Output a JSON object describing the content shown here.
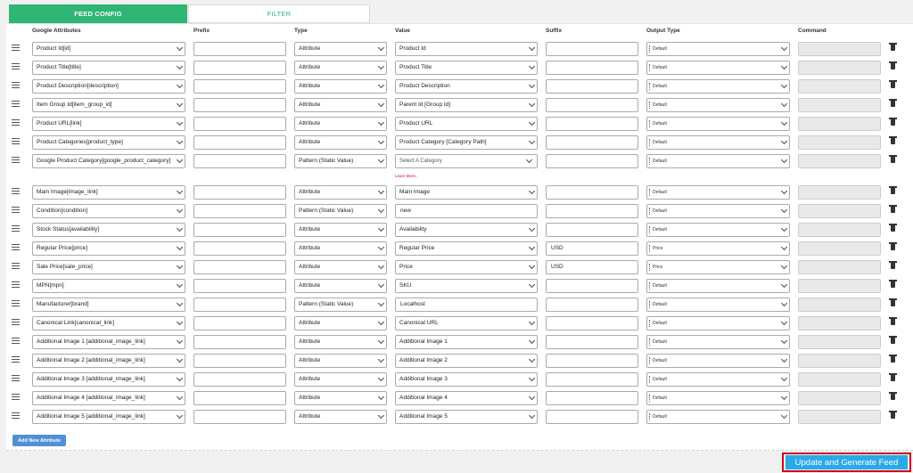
{
  "tabs": [
    {
      "label": "FEED CONFIG"
    },
    {
      "label": "FILTER"
    }
  ],
  "headers": {
    "google": "Google Attributes",
    "prefix": "Prefix",
    "type": "Type",
    "value": "Value",
    "suffix": "Suffix",
    "output": "Output Type",
    "command": "Command"
  },
  "rows": [
    {
      "google": "Product Id[id]",
      "prefix": "",
      "type": "Attribute",
      "value": "Product Id",
      "value_kind": "select",
      "suffix": "",
      "output": "Default"
    },
    {
      "google": "Product Title[title]",
      "prefix": "",
      "type": "Attribute",
      "value": "Product Title",
      "value_kind": "select",
      "suffix": "",
      "output": "Default"
    },
    {
      "google": "Product Description[description]",
      "prefix": "",
      "type": "Attribute",
      "value": "Product Description",
      "value_kind": "select",
      "suffix": "",
      "output": "Default"
    },
    {
      "google": "Item Group Id[item_group_id]",
      "prefix": "",
      "type": "Attribute",
      "value": "Parent Id [Group Id]",
      "value_kind": "select",
      "suffix": "",
      "output": "Default"
    },
    {
      "google": "Product URL[link]",
      "prefix": "",
      "type": "Attribute",
      "value": "Product URL",
      "value_kind": "select",
      "suffix": "",
      "output": "Default"
    },
    {
      "google": "Product Categories[product_type]",
      "prefix": "",
      "type": "Attribute",
      "value": "Product Category [Category Path]",
      "value_kind": "select",
      "suffix": "",
      "output": "Default"
    },
    {
      "google": "Google Product Category[google_product_category]",
      "prefix": "",
      "type": "Pattern (Static Value)",
      "value": "Select A Category",
      "value_kind": "category",
      "suffix": "",
      "output": "Default",
      "learn": "Learn More.."
    },
    {
      "google": "Main Image[image_link]",
      "prefix": "",
      "type": "Attribute",
      "value": "Main Image",
      "value_kind": "select",
      "suffix": "",
      "output": "Default"
    },
    {
      "google": "Condition[condition]",
      "prefix": "",
      "type": "Pattern (Static Value)",
      "value": "new",
      "value_kind": "input",
      "suffix": "",
      "output": "Default"
    },
    {
      "google": "Stock Status[availability]",
      "prefix": "",
      "type": "Attribute",
      "value": "Availability",
      "value_kind": "select",
      "suffix": "",
      "output": "Default"
    },
    {
      "google": "Regular Price[price]",
      "prefix": "",
      "type": "Attribute",
      "value": "Regular Price",
      "value_kind": "select",
      "suffix": "USD",
      "output": "Price"
    },
    {
      "google": "Sale Price[sale_price]",
      "prefix": "",
      "type": "Attribute",
      "value": "Price",
      "value_kind": "select",
      "suffix": "USD",
      "output": "Price"
    },
    {
      "google": "MPN[mpn]",
      "prefix": "",
      "type": "Attribute",
      "value": "SKU",
      "value_kind": "select",
      "suffix": "",
      "output": "Default"
    },
    {
      "google": "Manufacturer[brand]",
      "prefix": "",
      "type": "Pattern (Static Value)",
      "value": "Localhost",
      "value_kind": "input",
      "suffix": "",
      "output": "Default"
    },
    {
      "google": "Canonical Link[canonical_link]",
      "prefix": "",
      "type": "Attribute",
      "value": "Canonical URL",
      "value_kind": "select",
      "suffix": "",
      "output": "Default"
    },
    {
      "google": "Additional Image 1 [additional_image_link]",
      "prefix": "",
      "type": "Attribute",
      "value": "Additional Image 1",
      "value_kind": "select",
      "suffix": "",
      "output": "Default"
    },
    {
      "google": "Additional Image 2 [additional_image_link]",
      "prefix": "",
      "type": "Attribute",
      "value": "Additional Image 2",
      "value_kind": "select",
      "suffix": "",
      "output": "Default"
    },
    {
      "google": "Additional Image 3 [additional_image_link]",
      "prefix": "",
      "type": "Attribute",
      "value": "Additional Image 3",
      "value_kind": "select",
      "suffix": "",
      "output": "Default"
    },
    {
      "google": "Additional Image 4 [additional_image_link]",
      "prefix": "",
      "type": "Attribute",
      "value": "Additional Image 4",
      "value_kind": "select",
      "suffix": "",
      "output": "Default"
    },
    {
      "google": "Additional Image 5 [additional_image_link]",
      "prefix": "",
      "type": "Attribute",
      "value": "Additional Image 5",
      "value_kind": "select",
      "suffix": "",
      "output": "Default"
    }
  ],
  "add_button": "Add New Attribute",
  "generate_button": "Update and Generate Feed",
  "colors": {
    "accent": "#2fb675",
    "button_blue": "#2aa9e8",
    "highlight_border": "#d0021b"
  }
}
